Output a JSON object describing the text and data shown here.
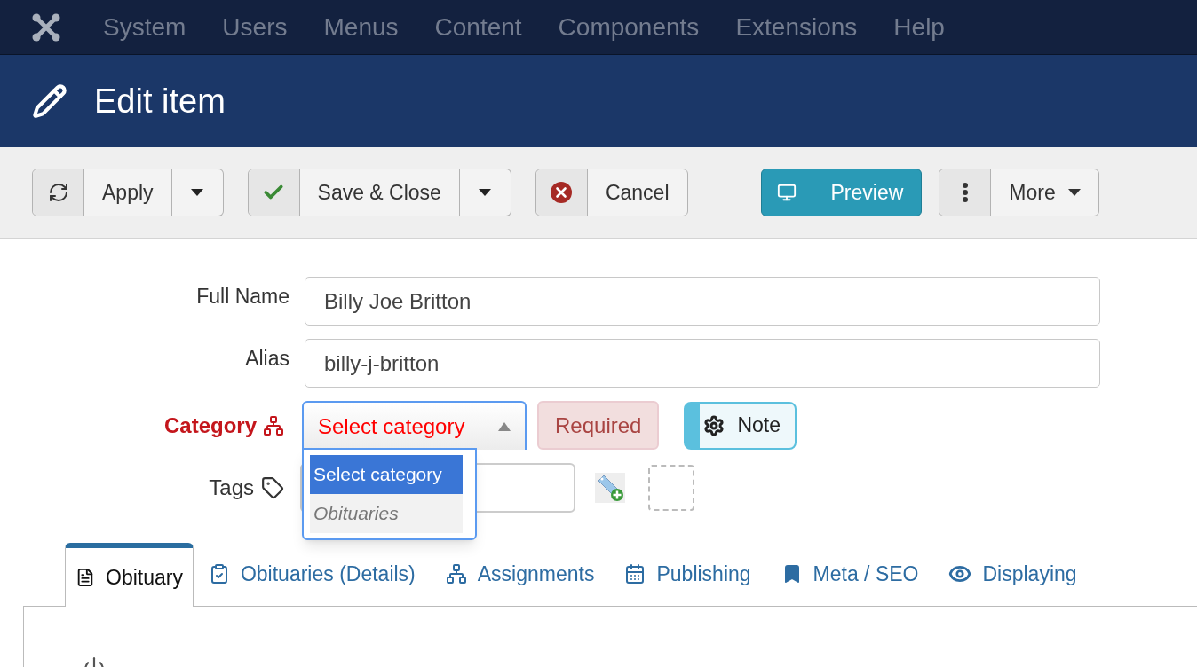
{
  "nav": {
    "items": [
      "System",
      "Users",
      "Menus",
      "Content",
      "Components",
      "Extensions",
      "Help"
    ]
  },
  "header": {
    "title": "Edit item"
  },
  "toolbar": [
    {
      "label": "Apply",
      "kind": "split"
    },
    {
      "label": "Save & Close",
      "kind": "split"
    },
    {
      "label": "Cancel",
      "kind": "plain"
    },
    {
      "label": "Preview",
      "kind": "primary"
    },
    {
      "label": "More",
      "kind": "menu"
    }
  ],
  "fields": [
    {
      "label": "Full Name",
      "value": "Billy Joe Britton"
    },
    {
      "label": "Alias",
      "value": "billy-j-britton"
    }
  ],
  "category": {
    "label": "Category",
    "required": true,
    "value": "Select category",
    "open": true,
    "options": [
      {
        "label": "Select category",
        "selected": true
      },
      {
        "label": "Obituaries",
        "selected": false
      }
    ],
    "badge": "Required",
    "note": "Note"
  },
  "tags": {
    "label": "Tags"
  },
  "tabs": [
    {
      "label": "Obituary",
      "selected": true
    },
    {
      "label": "Obituaries (Details)",
      "selected": false
    },
    {
      "label": "Assignments",
      "selected": false
    },
    {
      "label": "Publishing",
      "selected": false
    },
    {
      "label": "Meta / SEO",
      "selected": false
    },
    {
      "label": "Displaying",
      "selected": false
    }
  ]
}
